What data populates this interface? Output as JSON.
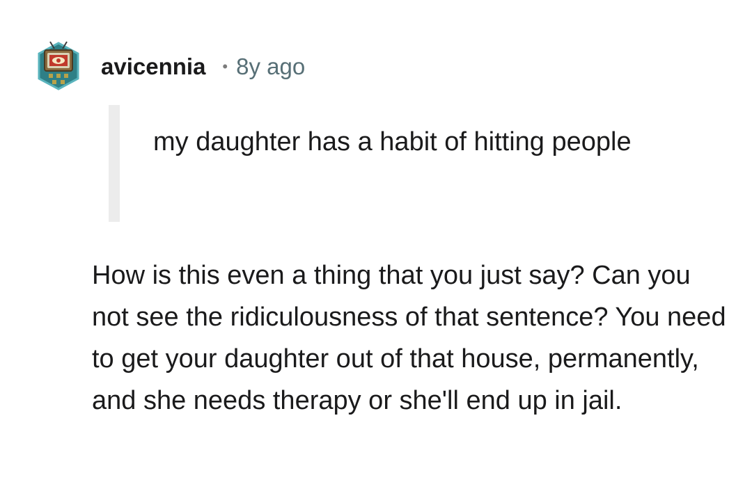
{
  "comment": {
    "author": "avicennia",
    "separator": "•",
    "timestamp": "8y ago",
    "avatar_icon": "snoo-tv-avatar-icon",
    "quote": "my daughter has a habit of hitting people",
    "body": "How is this even a thing that you just say? Can you not see the ridiculousness of that sentence? You need to get your daughter out of that house, permanently, and she needs therapy or she'll end up in jail."
  },
  "colors": {
    "username": "#1a1a1b",
    "timestamp": "#576f76",
    "quote_bar": "#ececec",
    "text": "#1a1a1b"
  }
}
